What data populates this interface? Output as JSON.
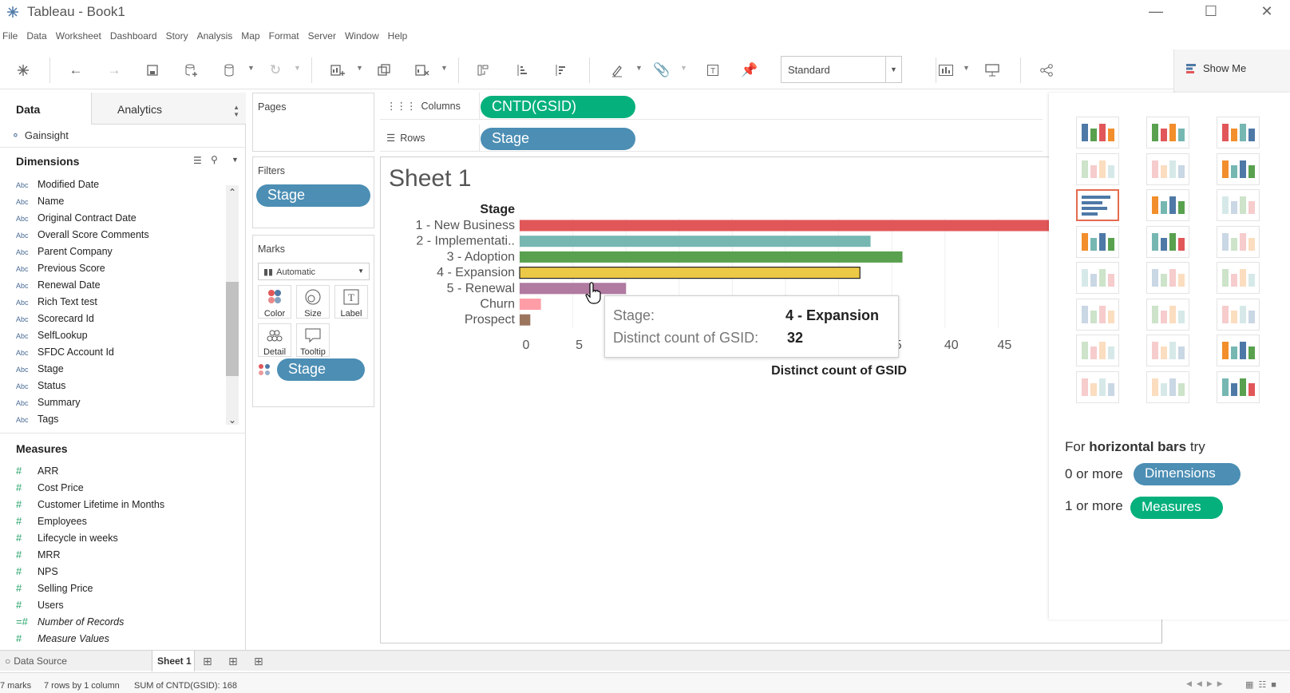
{
  "window": {
    "title": "Tableau - Book1",
    "controls": [
      "—",
      "☐",
      "✕"
    ]
  },
  "menu": [
    "File",
    "Data",
    "Worksheet",
    "Dashboard",
    "Story",
    "Analysis",
    "Map",
    "Format",
    "Server",
    "Window",
    "Help"
  ],
  "toolbar": {
    "fit_value": "Standard",
    "show_me_label": "Show Me"
  },
  "data_pane": {
    "tab_data": "Data",
    "tab_analytics": "Analytics",
    "source": "Gainsight",
    "dimensions_header": "Dimensions",
    "dimensions": [
      "Modified Date",
      "Name",
      "Original Contract Date",
      "Overall Score Comments",
      "Parent Company",
      "Previous Score",
      "Renewal Date",
      "Rich Text test",
      "Scorecard Id",
      "SelfLookup",
      "SFDC Account Id",
      "Stage",
      "Status",
      "Summary",
      "Tags"
    ],
    "dimension_type_label": "Abc",
    "measures_header": "Measures",
    "measures": [
      "ARR",
      "Cost Price",
      "Customer Lifetime in Months",
      "Employees",
      "Lifecycle in weeks",
      "MRR",
      "NPS",
      "Selling Price",
      "Users"
    ],
    "measures_italic": [
      "Number of Records",
      "Measure Values"
    ]
  },
  "pages": {
    "title": "Pages"
  },
  "filters": {
    "title": "Filters",
    "pills": [
      "Stage"
    ]
  },
  "marks": {
    "title": "Marks",
    "type": "Automatic",
    "buttons": [
      "Color",
      "Size",
      "Label",
      "Detail",
      "Tooltip"
    ],
    "color_pill": "Stage"
  },
  "shelves": {
    "columns_label": "Columns",
    "columns_pill": "CNTD(GSID)",
    "rows_label": "Rows",
    "rows_pill": "Stage"
  },
  "sheet": {
    "title": "Sheet 1"
  },
  "chart_data": {
    "type": "bar",
    "orientation": "horizontal",
    "row_header": "Stage",
    "categories": [
      "1 - New Business",
      "2 - Implementati..",
      "3 - Adoption",
      "4 - Expansion",
      "5 - Renewal",
      "Churn",
      "Prospect"
    ],
    "values": [
      50,
      33,
      36,
      32,
      10,
      2,
      1
    ],
    "colors": [
      "#e15759",
      "#76b7b2",
      "#59a14f",
      "#edc948",
      "#b07aa1",
      "#ff9da7",
      "#9c755f"
    ],
    "xlabel": "Distinct count of GSID",
    "x_ticks": [
      0,
      5,
      10,
      15,
      20,
      25,
      30,
      35,
      40,
      45
    ],
    "x_tick_labels": [
      "0",
      "5",
      "",
      "",
      "",
      "",
      "",
      "5",
      "40",
      "45"
    ],
    "xlim": [
      0,
      50
    ],
    "grid": true,
    "highlighted": "4 - Expansion"
  },
  "tooltip": {
    "stage_label": "Stage:",
    "stage_value": "4 - Expansion",
    "count_label": "Distinct count of GSID:",
    "count_value": "32"
  },
  "show_me": {
    "hint_prefix": "For ",
    "hint_bold": "horizontal bars",
    "hint_suffix": " try",
    "dims_prefix": "0 or more",
    "dims_pill": "Dimensions",
    "meas_prefix": "1 or more",
    "meas_pill": "Measures"
  },
  "bottom": {
    "data_source": "Data Source",
    "sheet_tab": "Sheet 1"
  },
  "status": {
    "marks": "7 marks",
    "rows_cols": "7 rows by 1 column",
    "sum": "SUM of CNTD(GSID): 168"
  }
}
